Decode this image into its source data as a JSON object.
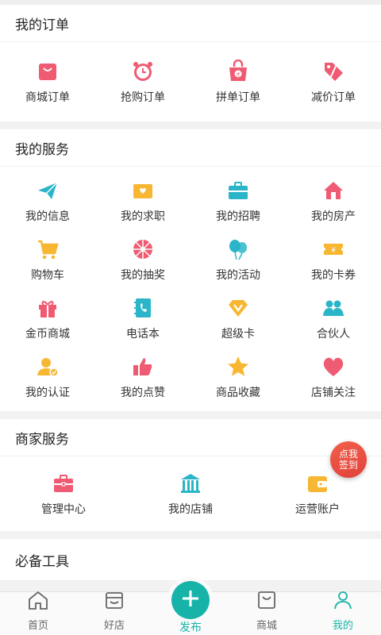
{
  "orders": {
    "title": "我的订单",
    "items": [
      {
        "label": "商城订单",
        "icon": "shopping-bag-icon"
      },
      {
        "label": "抢购订单",
        "icon": "alarm-clock-icon"
      },
      {
        "label": "拼单订单",
        "icon": "group-buy-bag-icon"
      },
      {
        "label": "减价订单",
        "icon": "price-tag-icon"
      }
    ]
  },
  "services": {
    "title": "我的服务",
    "items": [
      {
        "label": "我的信息",
        "icon": "paper-plane-icon"
      },
      {
        "label": "我的求职",
        "icon": "heart-envelope-icon"
      },
      {
        "label": "我的招聘",
        "icon": "briefcase-icon"
      },
      {
        "label": "我的房产",
        "icon": "house-icon"
      },
      {
        "label": "购物车",
        "icon": "cart-icon"
      },
      {
        "label": "我的抽奖",
        "icon": "lottery-wheel-icon"
      },
      {
        "label": "我的活动",
        "icon": "balloons-icon"
      },
      {
        "label": "我的卡券",
        "icon": "coupon-icon"
      },
      {
        "label": "金币商城",
        "icon": "gift-icon"
      },
      {
        "label": "电话本",
        "icon": "phone-book-icon"
      },
      {
        "label": "超级卡",
        "icon": "diamond-v-icon"
      },
      {
        "label": "合伙人",
        "icon": "partners-icon"
      },
      {
        "label": "我的认证",
        "icon": "verified-user-icon"
      },
      {
        "label": "我的点赞",
        "icon": "thumbs-up-icon"
      },
      {
        "label": "商品收藏",
        "icon": "star-icon"
      },
      {
        "label": "店铺关注",
        "icon": "heart-icon"
      }
    ]
  },
  "merchant": {
    "title": "商家服务",
    "items": [
      {
        "label": "管理中心",
        "icon": "toolbox-icon"
      },
      {
        "label": "我的店铺",
        "icon": "store-icon"
      },
      {
        "label": "运营账户",
        "icon": "wallet-icon"
      }
    ]
  },
  "tools": {
    "title": "必备工具"
  },
  "checkin": {
    "line1": "点我",
    "line2": "签到"
  },
  "tabbar": {
    "tabs": [
      {
        "label": "首页",
        "icon": "home-icon"
      },
      {
        "label": "好店",
        "icon": "shop-icon"
      },
      {
        "label": "发布",
        "icon": "plus-icon"
      },
      {
        "label": "商城",
        "icon": "mall-bag-icon"
      },
      {
        "label": "我的",
        "icon": "profile-icon"
      }
    ],
    "active": "我的"
  },
  "colors": {
    "accent": "#17b3a8",
    "pink": "#ef5b72",
    "yellow": "#f7b733",
    "teal": "#2bb5c8"
  }
}
